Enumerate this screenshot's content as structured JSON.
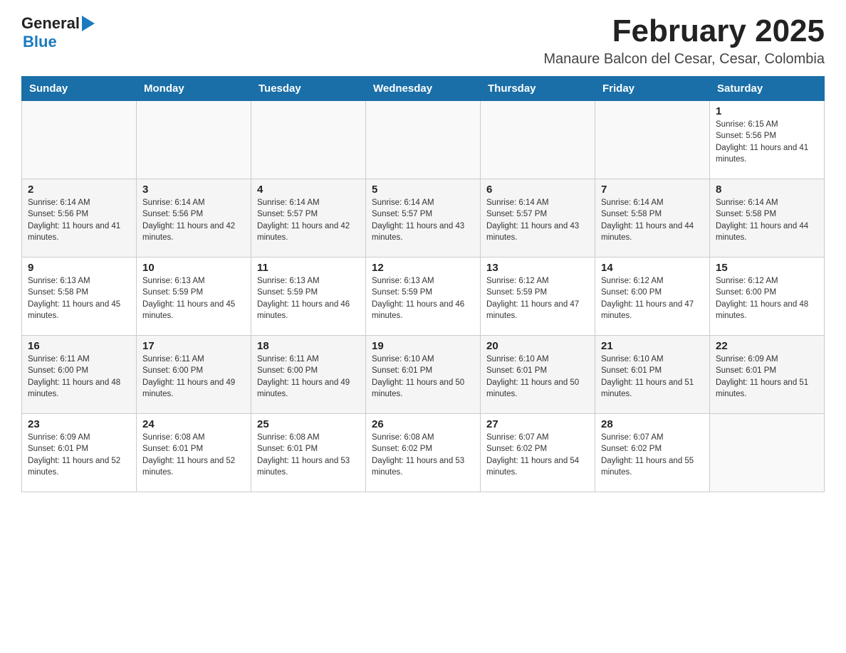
{
  "header": {
    "logo_general": "General",
    "logo_arrow": "▶",
    "logo_blue": "Blue",
    "month_title": "February 2025",
    "location": "Manaure Balcon del Cesar, Cesar, Colombia"
  },
  "weekdays": [
    "Sunday",
    "Monday",
    "Tuesday",
    "Wednesday",
    "Thursday",
    "Friday",
    "Saturday"
  ],
  "weeks": [
    {
      "days": [
        {
          "number": "",
          "info": ""
        },
        {
          "number": "",
          "info": ""
        },
        {
          "number": "",
          "info": ""
        },
        {
          "number": "",
          "info": ""
        },
        {
          "number": "",
          "info": ""
        },
        {
          "number": "",
          "info": ""
        },
        {
          "number": "1",
          "info": "Sunrise: 6:15 AM\nSunset: 5:56 PM\nDaylight: 11 hours and 41 minutes."
        }
      ]
    },
    {
      "days": [
        {
          "number": "2",
          "info": "Sunrise: 6:14 AM\nSunset: 5:56 PM\nDaylight: 11 hours and 41 minutes."
        },
        {
          "number": "3",
          "info": "Sunrise: 6:14 AM\nSunset: 5:56 PM\nDaylight: 11 hours and 42 minutes."
        },
        {
          "number": "4",
          "info": "Sunrise: 6:14 AM\nSunset: 5:57 PM\nDaylight: 11 hours and 42 minutes."
        },
        {
          "number": "5",
          "info": "Sunrise: 6:14 AM\nSunset: 5:57 PM\nDaylight: 11 hours and 43 minutes."
        },
        {
          "number": "6",
          "info": "Sunrise: 6:14 AM\nSunset: 5:57 PM\nDaylight: 11 hours and 43 minutes."
        },
        {
          "number": "7",
          "info": "Sunrise: 6:14 AM\nSunset: 5:58 PM\nDaylight: 11 hours and 44 minutes."
        },
        {
          "number": "8",
          "info": "Sunrise: 6:14 AM\nSunset: 5:58 PM\nDaylight: 11 hours and 44 minutes."
        }
      ]
    },
    {
      "days": [
        {
          "number": "9",
          "info": "Sunrise: 6:13 AM\nSunset: 5:58 PM\nDaylight: 11 hours and 45 minutes."
        },
        {
          "number": "10",
          "info": "Sunrise: 6:13 AM\nSunset: 5:59 PM\nDaylight: 11 hours and 45 minutes."
        },
        {
          "number": "11",
          "info": "Sunrise: 6:13 AM\nSunset: 5:59 PM\nDaylight: 11 hours and 46 minutes."
        },
        {
          "number": "12",
          "info": "Sunrise: 6:13 AM\nSunset: 5:59 PM\nDaylight: 11 hours and 46 minutes."
        },
        {
          "number": "13",
          "info": "Sunrise: 6:12 AM\nSunset: 5:59 PM\nDaylight: 11 hours and 47 minutes."
        },
        {
          "number": "14",
          "info": "Sunrise: 6:12 AM\nSunset: 6:00 PM\nDaylight: 11 hours and 47 minutes."
        },
        {
          "number": "15",
          "info": "Sunrise: 6:12 AM\nSunset: 6:00 PM\nDaylight: 11 hours and 48 minutes."
        }
      ]
    },
    {
      "days": [
        {
          "number": "16",
          "info": "Sunrise: 6:11 AM\nSunset: 6:00 PM\nDaylight: 11 hours and 48 minutes."
        },
        {
          "number": "17",
          "info": "Sunrise: 6:11 AM\nSunset: 6:00 PM\nDaylight: 11 hours and 49 minutes."
        },
        {
          "number": "18",
          "info": "Sunrise: 6:11 AM\nSunset: 6:00 PM\nDaylight: 11 hours and 49 minutes."
        },
        {
          "number": "19",
          "info": "Sunrise: 6:10 AM\nSunset: 6:01 PM\nDaylight: 11 hours and 50 minutes."
        },
        {
          "number": "20",
          "info": "Sunrise: 6:10 AM\nSunset: 6:01 PM\nDaylight: 11 hours and 50 minutes."
        },
        {
          "number": "21",
          "info": "Sunrise: 6:10 AM\nSunset: 6:01 PM\nDaylight: 11 hours and 51 minutes."
        },
        {
          "number": "22",
          "info": "Sunrise: 6:09 AM\nSunset: 6:01 PM\nDaylight: 11 hours and 51 minutes."
        }
      ]
    },
    {
      "days": [
        {
          "number": "23",
          "info": "Sunrise: 6:09 AM\nSunset: 6:01 PM\nDaylight: 11 hours and 52 minutes."
        },
        {
          "number": "24",
          "info": "Sunrise: 6:08 AM\nSunset: 6:01 PM\nDaylight: 11 hours and 52 minutes."
        },
        {
          "number": "25",
          "info": "Sunrise: 6:08 AM\nSunset: 6:01 PM\nDaylight: 11 hours and 53 minutes."
        },
        {
          "number": "26",
          "info": "Sunrise: 6:08 AM\nSunset: 6:02 PM\nDaylight: 11 hours and 53 minutes."
        },
        {
          "number": "27",
          "info": "Sunrise: 6:07 AM\nSunset: 6:02 PM\nDaylight: 11 hours and 54 minutes."
        },
        {
          "number": "28",
          "info": "Sunrise: 6:07 AM\nSunset: 6:02 PM\nDaylight: 11 hours and 55 minutes."
        },
        {
          "number": "",
          "info": ""
        }
      ]
    }
  ]
}
